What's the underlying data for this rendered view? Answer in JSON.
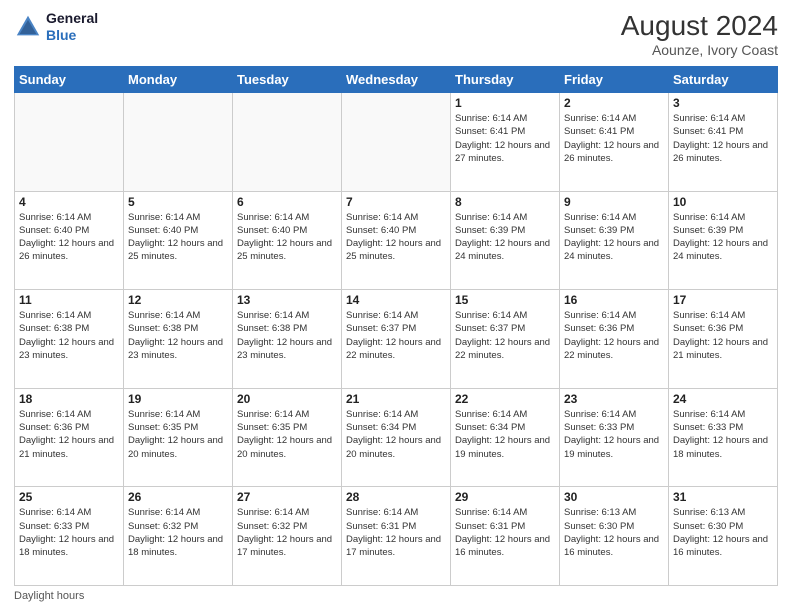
{
  "header": {
    "logo_line1": "General",
    "logo_line2": "Blue",
    "month_year": "August 2024",
    "location": "Aounze, Ivory Coast"
  },
  "days_of_week": [
    "Sunday",
    "Monday",
    "Tuesday",
    "Wednesday",
    "Thursday",
    "Friday",
    "Saturday"
  ],
  "weeks": [
    [
      {
        "day": "",
        "info": ""
      },
      {
        "day": "",
        "info": ""
      },
      {
        "day": "",
        "info": ""
      },
      {
        "day": "",
        "info": ""
      },
      {
        "day": "1",
        "info": "Sunrise: 6:14 AM\nSunset: 6:41 PM\nDaylight: 12 hours and 27 minutes."
      },
      {
        "day": "2",
        "info": "Sunrise: 6:14 AM\nSunset: 6:41 PM\nDaylight: 12 hours and 26 minutes."
      },
      {
        "day": "3",
        "info": "Sunrise: 6:14 AM\nSunset: 6:41 PM\nDaylight: 12 hours and 26 minutes."
      }
    ],
    [
      {
        "day": "4",
        "info": "Sunrise: 6:14 AM\nSunset: 6:40 PM\nDaylight: 12 hours and 26 minutes."
      },
      {
        "day": "5",
        "info": "Sunrise: 6:14 AM\nSunset: 6:40 PM\nDaylight: 12 hours and 25 minutes."
      },
      {
        "day": "6",
        "info": "Sunrise: 6:14 AM\nSunset: 6:40 PM\nDaylight: 12 hours and 25 minutes."
      },
      {
        "day": "7",
        "info": "Sunrise: 6:14 AM\nSunset: 6:40 PM\nDaylight: 12 hours and 25 minutes."
      },
      {
        "day": "8",
        "info": "Sunrise: 6:14 AM\nSunset: 6:39 PM\nDaylight: 12 hours and 24 minutes."
      },
      {
        "day": "9",
        "info": "Sunrise: 6:14 AM\nSunset: 6:39 PM\nDaylight: 12 hours and 24 minutes."
      },
      {
        "day": "10",
        "info": "Sunrise: 6:14 AM\nSunset: 6:39 PM\nDaylight: 12 hours and 24 minutes."
      }
    ],
    [
      {
        "day": "11",
        "info": "Sunrise: 6:14 AM\nSunset: 6:38 PM\nDaylight: 12 hours and 23 minutes."
      },
      {
        "day": "12",
        "info": "Sunrise: 6:14 AM\nSunset: 6:38 PM\nDaylight: 12 hours and 23 minutes."
      },
      {
        "day": "13",
        "info": "Sunrise: 6:14 AM\nSunset: 6:38 PM\nDaylight: 12 hours and 23 minutes."
      },
      {
        "day": "14",
        "info": "Sunrise: 6:14 AM\nSunset: 6:37 PM\nDaylight: 12 hours and 22 minutes."
      },
      {
        "day": "15",
        "info": "Sunrise: 6:14 AM\nSunset: 6:37 PM\nDaylight: 12 hours and 22 minutes."
      },
      {
        "day": "16",
        "info": "Sunrise: 6:14 AM\nSunset: 6:36 PM\nDaylight: 12 hours and 22 minutes."
      },
      {
        "day": "17",
        "info": "Sunrise: 6:14 AM\nSunset: 6:36 PM\nDaylight: 12 hours and 21 minutes."
      }
    ],
    [
      {
        "day": "18",
        "info": "Sunrise: 6:14 AM\nSunset: 6:36 PM\nDaylight: 12 hours and 21 minutes."
      },
      {
        "day": "19",
        "info": "Sunrise: 6:14 AM\nSunset: 6:35 PM\nDaylight: 12 hours and 20 minutes."
      },
      {
        "day": "20",
        "info": "Sunrise: 6:14 AM\nSunset: 6:35 PM\nDaylight: 12 hours and 20 minutes."
      },
      {
        "day": "21",
        "info": "Sunrise: 6:14 AM\nSunset: 6:34 PM\nDaylight: 12 hours and 20 minutes."
      },
      {
        "day": "22",
        "info": "Sunrise: 6:14 AM\nSunset: 6:34 PM\nDaylight: 12 hours and 19 minutes."
      },
      {
        "day": "23",
        "info": "Sunrise: 6:14 AM\nSunset: 6:33 PM\nDaylight: 12 hours and 19 minutes."
      },
      {
        "day": "24",
        "info": "Sunrise: 6:14 AM\nSunset: 6:33 PM\nDaylight: 12 hours and 18 minutes."
      }
    ],
    [
      {
        "day": "25",
        "info": "Sunrise: 6:14 AM\nSunset: 6:33 PM\nDaylight: 12 hours and 18 minutes."
      },
      {
        "day": "26",
        "info": "Sunrise: 6:14 AM\nSunset: 6:32 PM\nDaylight: 12 hours and 18 minutes."
      },
      {
        "day": "27",
        "info": "Sunrise: 6:14 AM\nSunset: 6:32 PM\nDaylight: 12 hours and 17 minutes."
      },
      {
        "day": "28",
        "info": "Sunrise: 6:14 AM\nSunset: 6:31 PM\nDaylight: 12 hours and 17 minutes."
      },
      {
        "day": "29",
        "info": "Sunrise: 6:14 AM\nSunset: 6:31 PM\nDaylight: 12 hours and 16 minutes."
      },
      {
        "day": "30",
        "info": "Sunrise: 6:13 AM\nSunset: 6:30 PM\nDaylight: 12 hours and 16 minutes."
      },
      {
        "day": "31",
        "info": "Sunrise: 6:13 AM\nSunset: 6:30 PM\nDaylight: 12 hours and 16 minutes."
      }
    ]
  ],
  "footer": {
    "note": "Daylight hours"
  }
}
